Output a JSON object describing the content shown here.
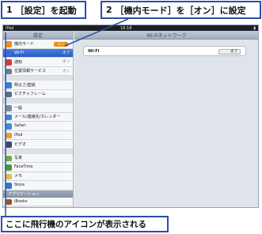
{
  "callouts": {
    "step1": {
      "num": "1",
      "text": "［設定］を起動"
    },
    "step2": {
      "num": "2",
      "text": "［機内モード］を［オン］に設定"
    },
    "note": {
      "text": "ここに飛行機のアイコンが表示される"
    }
  },
  "statusbar": {
    "left": "iPad",
    "center": "16:18"
  },
  "sidebar": {
    "title": "設定",
    "items": [
      {
        "label": "機内モード",
        "value": "オン",
        "icon": "airplane-icon",
        "color": "#f08c1c"
      },
      {
        "label": "Wi-Fi",
        "value": "オフ",
        "icon": "wifi-icon",
        "color": "#2e6fd8"
      },
      {
        "label": "通知",
        "value": "オン",
        "icon": "notifications-icon",
        "color": "#d83a3a"
      },
      {
        "label": "位置情報サービス",
        "value": "オン",
        "icon": "location-icon",
        "color": "#6b7a8f"
      },
      {
        "label": "明るさ/壁紙",
        "value": "",
        "icon": "brightness-icon",
        "color": "#3a7fd0"
      },
      {
        "label": "ピクチャフレーム",
        "value": "",
        "icon": "picture-frame-icon",
        "color": "#5c6c80"
      },
      {
        "label": "一般",
        "value": "",
        "icon": "gear-icon",
        "color": "#7f8892"
      },
      {
        "label": "メール/連絡先/カレンダー",
        "value": "",
        "icon": "mail-icon",
        "color": "#3d86d8"
      },
      {
        "label": "Safari",
        "value": "",
        "icon": "safari-icon",
        "color": "#3a8de0"
      },
      {
        "label": "iPod",
        "value": "",
        "icon": "ipod-icon",
        "color": "#f09a28"
      },
      {
        "label": "ビデオ",
        "value": "",
        "icon": "video-icon",
        "color": "#3b4b66"
      },
      {
        "label": "写真",
        "value": "",
        "icon": "photos-icon",
        "color": "#6cae3c"
      },
      {
        "label": "FaceTime",
        "value": "",
        "icon": "facetime-icon",
        "color": "#4b9a3a"
      },
      {
        "label": "メモ",
        "value": "",
        "icon": "notes-icon",
        "color": "#e0c04a"
      },
      {
        "label": "Store",
        "value": "",
        "icon": "store-icon",
        "color": "#3a78d0"
      }
    ],
    "section_title": "アプリケーション",
    "last_item": "iBooks"
  },
  "detail": {
    "title": "Wi-Fiネットワーク",
    "wifi_label": "Wi-Fi",
    "wifi_value": "オフ"
  },
  "colors": {
    "callout_border": "#2a4fa8",
    "selected": "#2a5cc6",
    "toggle_on": "#f08c1c"
  }
}
